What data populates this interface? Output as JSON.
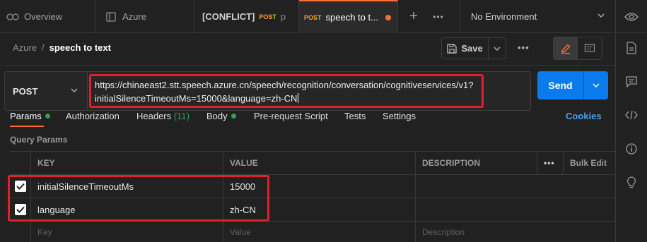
{
  "tabs": [
    {
      "label": "Overview",
      "icon": "overview-icon"
    },
    {
      "label": "Azure",
      "icon": "collection-icon"
    },
    {
      "label": "[CONFLICT]",
      "method": "POST",
      "suffix": "p"
    },
    {
      "label": "speech to t...",
      "method": "POST",
      "active": true,
      "unsaved": true
    }
  ],
  "tabbar": {
    "new_tab": "+",
    "more": "•••"
  },
  "environment": {
    "label": "No Environment"
  },
  "breadcrumb": {
    "parent": "Azure",
    "separator": "/",
    "current": "speech to text"
  },
  "toolbar": {
    "save_label": "Save",
    "more": "•••"
  },
  "request": {
    "method": "POST",
    "url_line1": "https://chinaeast2.stt.speech.azure.cn/speech/recognition/conversation/cognitiveservices/v1?",
    "url_line2": "initialSilenceTimeoutMs=15000&language=zh-CN",
    "send_label": "Send"
  },
  "subtabs": {
    "params": "Params",
    "authorization": "Authorization",
    "headers": "Headers",
    "headers_count": "(11)",
    "body": "Body",
    "prerequest": "Pre-request Script",
    "tests": "Tests",
    "settings": "Settings",
    "cookies": "Cookies"
  },
  "query_params": {
    "title": "Query Params",
    "columns": {
      "key": "KEY",
      "value": "VALUE",
      "description": "DESCRIPTION",
      "more": "•••",
      "bulk_edit": "Bulk Edit"
    },
    "rows": [
      {
        "key": "initialSilenceTimeoutMs",
        "value": "15000",
        "checked": true
      },
      {
        "key": "language",
        "value": "zh-CN",
        "checked": true
      }
    ],
    "placeholders": {
      "key": "Key",
      "value": "Value",
      "description": "Description"
    }
  },
  "colors": {
    "accent": "#ff6c37",
    "send": "#097bed",
    "highlight": "#e0202a",
    "active_dot": "#2ea44f",
    "link": "#4a9df8"
  }
}
